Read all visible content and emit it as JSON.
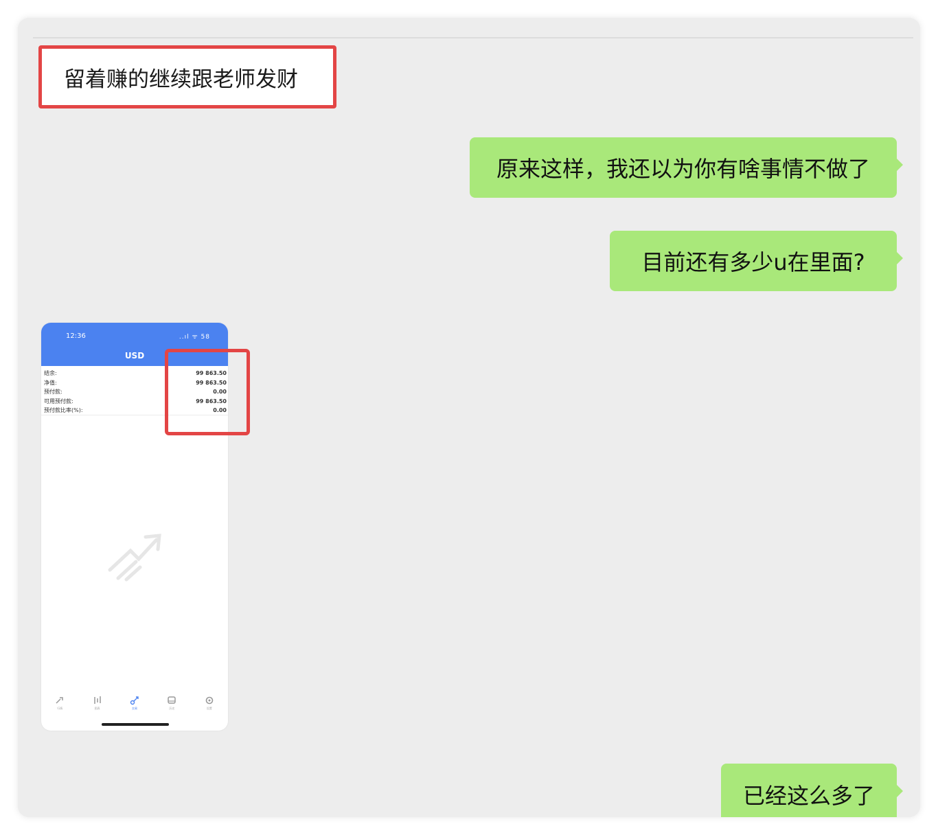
{
  "messages": {
    "incoming_text": "留着赚的继续跟老师发财",
    "outgoing_1": "原来这样，我还以为你有啥事情不做了",
    "outgoing_2": "目前还有多少u在里面?",
    "outgoing_3": "已经这么多了"
  },
  "phone": {
    "time": "12:36",
    "status": "..ıl ᯤ 58",
    "title": "USD",
    "rows": [
      {
        "label": "结余:",
        "value": "99 863.50"
      },
      {
        "label": "净值:",
        "value": "99 863.50"
      },
      {
        "label": "预付款:",
        "value": "0.00"
      },
      {
        "label": "可用预付款:",
        "value": "99 863.50"
      },
      {
        "label": "预付款比率(%):",
        "value": "0.00"
      }
    ],
    "tabs": [
      {
        "icon": "quotes-icon",
        "label": "行情"
      },
      {
        "icon": "chart-icon",
        "label": "图表"
      },
      {
        "icon": "trade-icon",
        "label": "交易"
      },
      {
        "icon": "history-icon",
        "label": "历史"
      },
      {
        "icon": "settings-icon",
        "label": "设置"
      }
    ],
    "active_tab": 2
  },
  "colors": {
    "bubble_green": "#a9e87a",
    "highlight_red": "#e34545",
    "phone_blue": "#4b82f0",
    "chat_bg": "#ededed"
  }
}
